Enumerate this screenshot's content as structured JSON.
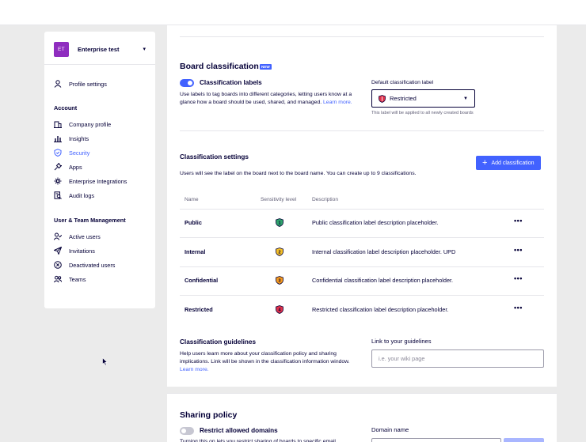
{
  "org": {
    "initials": "ET",
    "name": "Enterprise test",
    "badge_color": "#8f2dbf"
  },
  "sidebar": {
    "profile": "Profile settings",
    "account_title": "Account",
    "account_items": [
      {
        "label": "Company profile",
        "icon": "building-icon"
      },
      {
        "label": "Insights",
        "icon": "bar-chart-icon"
      },
      {
        "label": "Security",
        "icon": "shield-icon",
        "active": true
      },
      {
        "label": "Apps",
        "icon": "plug-icon"
      },
      {
        "label": "Enterprise Integrations",
        "icon": "integrations-icon"
      },
      {
        "label": "Audit logs",
        "icon": "audit-log-icon"
      }
    ],
    "team_title": "User & Team Management",
    "team_items": [
      {
        "label": "Active users",
        "icon": "user-check-icon"
      },
      {
        "label": "Invitations",
        "icon": "send-icon"
      },
      {
        "label": "Deactivated users",
        "icon": "circle-x-icon"
      },
      {
        "label": "Teams",
        "icon": "team-icon"
      }
    ]
  },
  "board_classification": {
    "title": "Board classification",
    "new_badge": "NEW",
    "toggle_label": "Classification labels",
    "toggle_on": true,
    "description": "Use labels to tag boards into different categories, letting users know at a glance how a board should be used, shared, and managed.",
    "learn_more": "Learn more.",
    "default_label_title": "Default classification label",
    "default_value": "Restricted",
    "default_hint": "This label will be applied to all newly created boards"
  },
  "classification_settings": {
    "title": "Classification settings",
    "description": "Users will see the label on the board next to the board name. You can create up to 9 classifications.",
    "add_button": "Add classification",
    "columns": [
      "Name",
      "Sensitivity level",
      "Description"
    ],
    "rows": [
      {
        "name": "Public",
        "level": "1",
        "color": "#2fa36b",
        "description": "Public classification label description placeholder."
      },
      {
        "name": "Internal",
        "level": "2",
        "color": "#f5c026",
        "description": "Internal classification label description placeholder. UPD"
      },
      {
        "name": "Confidential",
        "level": "3",
        "color": "#f59a1e",
        "description": "Confidential classification label description placeholder."
      },
      {
        "name": "Restricted",
        "level": "4",
        "color": "#e0324b",
        "description": "Restricted classification label description placeholder."
      }
    ],
    "more_glyph": "•••"
  },
  "guidelines": {
    "title": "Classification guidelines",
    "description": "Help users learn more about your classification policy and sharing implications. Link will be shown in the classification information window.",
    "learn_more": "Learn more.",
    "link_title": "Link to your guidelines",
    "link_placeholder": "i.e. your wiki page"
  },
  "sharing": {
    "title": "Sharing policy",
    "toggle_label": "Restrict allowed domains",
    "toggle_on": false,
    "description": "Turning this on lets you restrict sharing of boards to specific email",
    "domain_title": "Domain name"
  },
  "colors": {
    "accent": "#4262ff",
    "text": "#050038",
    "muted": "#626078"
  }
}
